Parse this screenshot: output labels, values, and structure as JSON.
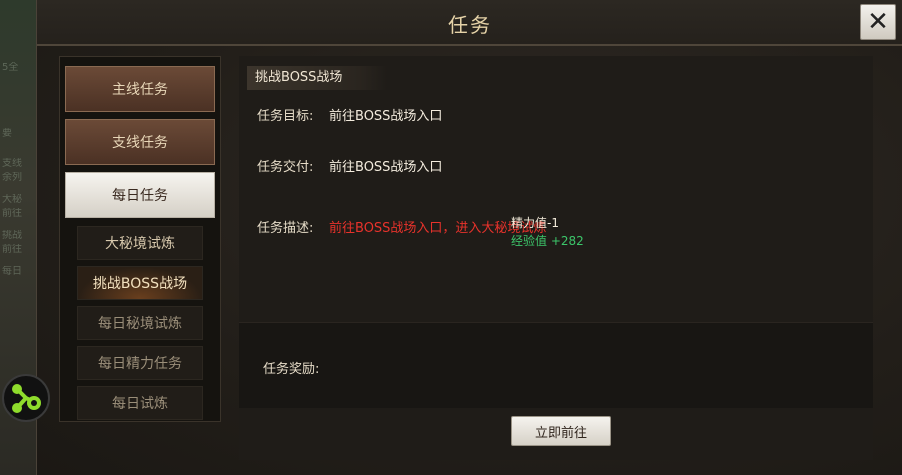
{
  "window": {
    "title": "任务",
    "close_icon": "close-icon"
  },
  "background": {
    "ghost_lines": [
      "5全",
      "要",
      "支线",
      "余列",
      "大秘",
      "前往",
      "挑战",
      "前往",
      "每日"
    ]
  },
  "tabs": {
    "main": [
      {
        "label": "主线任务",
        "active": false
      },
      {
        "label": "支线任务",
        "active": false
      },
      {
        "label": "每日任务",
        "active": true
      }
    ],
    "sub": [
      {
        "label": "大秘境试炼"
      },
      {
        "label": "挑战BOSS战场"
      },
      {
        "label": "每日秘境试炼"
      },
      {
        "label": "每日精力任务"
      },
      {
        "label": "每日试炼"
      }
    ]
  },
  "quest": {
    "title": "挑战BOSS战场",
    "goal_label": "任务目标:",
    "goal_value": "前往BOSS战场入口",
    "submit_label": "任务交付:",
    "submit_value": "前往BOSS战场入口",
    "desc_label": "任务描述:",
    "desc_value": "前往BOSS战场入口，进入大秘境试炼",
    "float_stamina": "精力值-1",
    "float_exp": "经验值 +282",
    "reward_label": "任务奖励:",
    "go_button": "立即前往"
  },
  "colors": {
    "accent_gold": "#e6d3a8",
    "desc_red": "#e8322b",
    "exp_green": "#3cc66a"
  }
}
